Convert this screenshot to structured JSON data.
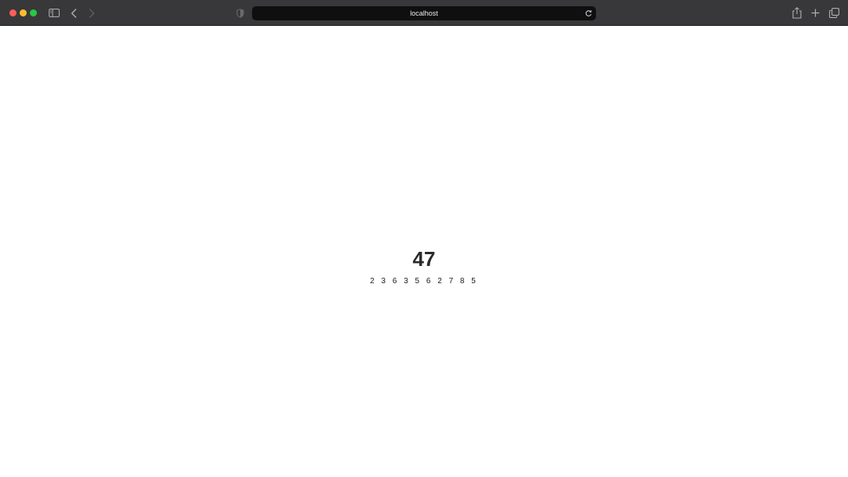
{
  "browser": {
    "address": "localhost",
    "icons": {
      "sidebar": "sidebar-icon",
      "back": "chevron-left-icon",
      "forward": "chevron-right-icon",
      "privacy": "shield-icon",
      "reload": "reload-icon",
      "share": "share-icon",
      "new_tab": "plus-icon",
      "tab_overview": "tabs-overview-icon"
    }
  },
  "page": {
    "number": "47",
    "digits": "2 3 6 3 5 6 2 7 8 5"
  }
}
